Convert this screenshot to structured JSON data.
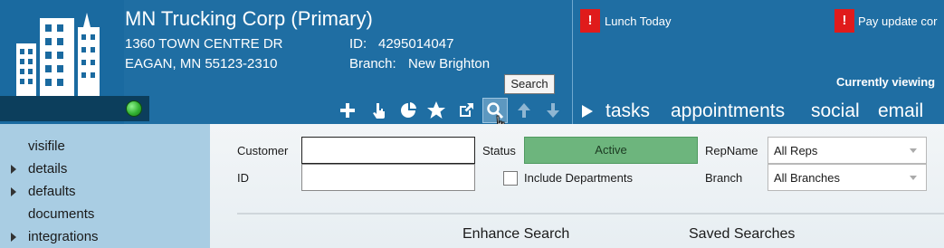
{
  "header": {
    "company_name": "MN Trucking Corp (Primary)",
    "address_line1": "1360 TOWN CENTRE DR",
    "address_line2": "EAGAN, MN   55123-2310",
    "id_label": "ID:",
    "id_value": "4295014047",
    "branch_label": "Branch:",
    "branch_value": "New Brighton",
    "status_color": "#32b232"
  },
  "alerts": [
    {
      "icon": "!",
      "text": "Lunch Today"
    },
    {
      "icon": "!",
      "text": "Pay update cor"
    }
  ],
  "currently_viewing": "Currently viewing",
  "toolbar": {
    "icons": [
      "plus-icon",
      "pointer-hand-icon",
      "pie-chart-icon",
      "star-icon",
      "external-link-icon",
      "search-icon",
      "arrow-up-icon",
      "arrow-down-icon"
    ],
    "tooltip": "Search"
  },
  "nav_tabs": [
    "tasks",
    "appointments",
    "social",
    "email"
  ],
  "sidebar": {
    "items": [
      {
        "label": "visifile",
        "expandable": false
      },
      {
        "label": "details",
        "expandable": true
      },
      {
        "label": "defaults",
        "expandable": true
      },
      {
        "label": "documents",
        "expandable": false
      },
      {
        "label": "integrations",
        "expandable": true
      }
    ]
  },
  "search_form": {
    "customer_label": "Customer",
    "customer_value": "",
    "id_label": "ID",
    "id_value": "",
    "status_label": "Status",
    "status_value": "Active",
    "include_departments_label": "Include Departments",
    "include_departments_checked": false,
    "repname_label": "RepName",
    "repname_value": "All Reps",
    "branch_label": "Branch",
    "branch_value": "All Branches"
  },
  "sections": {
    "enhance_search": "Enhance Search",
    "saved_searches": "Saved Searches"
  },
  "colors": {
    "header_bg": "#1f6ea3",
    "sidebar_bg": "#a9cde3",
    "status_active_bg": "#6db57d",
    "alert_red": "#e01b1b"
  }
}
